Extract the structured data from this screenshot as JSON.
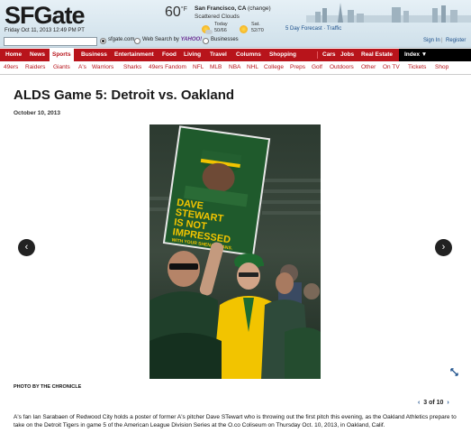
{
  "header": {
    "logo": "SFGate",
    "dateline": "Friday Oct 11, 2013 12:49 PM PT",
    "weather": {
      "temp": "60",
      "unit": "°F",
      "city": "San Francisco, CA",
      "change": "(change)",
      "condition": "Scattered Clouds",
      "today_label": "Today",
      "today_hilo": "50/66",
      "sat_label": "Sat.",
      "sat_hilo": "52/70",
      "forecast_link": "5 Day Forecast",
      "traffic_link": "Traffic",
      "sep": "·"
    },
    "search": {
      "value": "",
      "opt1": "sfgate.com",
      "opt2_prefix": "Web Search by",
      "opt2_brand": "YAHOO!",
      "opt3": "Businesses"
    },
    "auth": {
      "signin": "Sign In",
      "sep": "|",
      "register": "Register"
    }
  },
  "nav": {
    "items": [
      "Home",
      "News",
      "Sports",
      "Business",
      "Entertainment",
      "Food",
      "Living",
      "Travel",
      "Columns",
      "Shopping",
      "Cars",
      "Jobs",
      "Real Estate",
      "Index ▼"
    ]
  },
  "subnav": {
    "items": [
      "49ers",
      "Raiders",
      "Giants",
      "A's",
      "Warriors",
      "Sharks",
      "49ers Fandom",
      "NFL",
      "MLB",
      "NBA",
      "NHL",
      "College",
      "Preps",
      "Golf",
      "Outdoors",
      "Other",
      "On TV",
      "Tickets",
      "Shop"
    ]
  },
  "article": {
    "title": "ALDS Game 5: Detroit vs. Oakland",
    "date": "October 10, 2013",
    "photo_alt": "A's fan holding Dave Stewart poster",
    "poster_lines": [
      "DAVE",
      "STEWART",
      "IS NOT",
      "IMPRESSED",
      "WITH YOUR SHENANIGANS."
    ],
    "credit": "PHOTO BY THE CHRONICLE",
    "pager": {
      "prev": "‹",
      "current": "3",
      "of": "of 10",
      "next": "›"
    },
    "caption": "A's fan Ian Sarabaen of Redwood City holds a poster of former A's pitcher Dave STewart who is throwing out the first pitch this evening, as the Oakland Athletics prepare to take on the Detroit Tigers in game 5 of the American League Division Series at the O.co Coliseum on Thursday Oct. 10, 2013, in Oakland, Calif."
  },
  "colors": {
    "brand_red": "#b8141b",
    "link_blue": "#1a4e8a",
    "accent_yellow": "#f2c400",
    "accent_green": "#1f5a2c"
  }
}
